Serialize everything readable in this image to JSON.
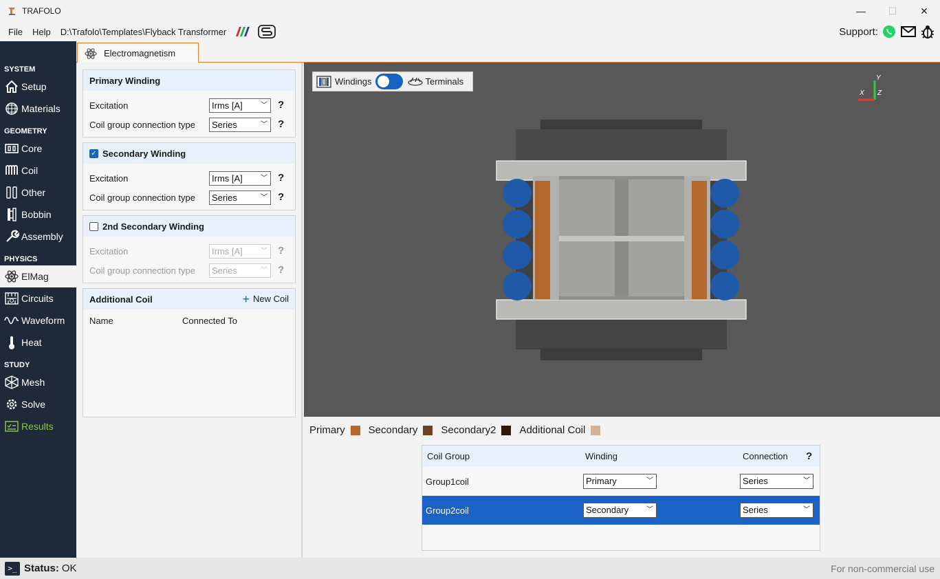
{
  "window": {
    "title": "TRAFOLO",
    "minimize": "—",
    "maximize": "☐",
    "close": "✕"
  },
  "menu": {
    "file": "File",
    "help": "Help",
    "path": "D:\\Trafolo\\Templates\\Flyback Transformer",
    "support": "Support:"
  },
  "tab": {
    "label": "Electromagnetism"
  },
  "sidebar": {
    "system": "SYSTEM",
    "setup": "Setup",
    "materials": "Materials",
    "geometry": "GEOMETRY",
    "core": "Core",
    "coil": "Coil",
    "other": "Other",
    "bobbin": "Bobbin",
    "assembly": "Assembly",
    "physics": "PHYSICS",
    "elmag": "ElMag",
    "circuits": "Circuits",
    "waveform": "Waveform",
    "heat": "Heat",
    "study": "STUDY",
    "mesh": "Mesh",
    "solve": "Solve",
    "results": "Results"
  },
  "panel": {
    "primary": {
      "title": "Primary Winding",
      "excitation_label": "Excitation",
      "excitation_value": "Irms [A]",
      "conn_label": "Coil group connection type",
      "conn_value": "Series"
    },
    "secondary": {
      "title": "Secondary Winding",
      "checked": true,
      "excitation_label": "Excitation",
      "excitation_value": "Irms [A]",
      "conn_label": "Coil group connection type",
      "conn_value": "Series"
    },
    "secondary2": {
      "title": "2nd Secondary Winding",
      "checked": false,
      "excitation_label": "Excitation",
      "excitation_value": "Irms [A]",
      "conn_label": "Coil group connection type",
      "conn_value": "Series"
    },
    "additional": {
      "title": "Additional Coil",
      "new_coil": "New Coil",
      "col_name": "Name",
      "col_connected": "Connected To"
    },
    "help": "?"
  },
  "viewport": {
    "windings": "Windings",
    "terminals": "Terminals",
    "axis_x": "X",
    "axis_y": "Y",
    "axis_z": "Z"
  },
  "legend": [
    {
      "label": "Primary",
      "color": "#b5682e"
    },
    {
      "label": "Secondary",
      "color": "#6a4420"
    },
    {
      "label": "Secondary2",
      "color": "#2e1a0c"
    },
    {
      "label": "Additional Coil",
      "color": "#d2b39a"
    }
  ],
  "coil_table": {
    "headers": {
      "group": "Coil Group",
      "winding": "Winding",
      "connection": "Connection",
      "help": "?"
    },
    "rows": [
      {
        "group": "Group1coil",
        "winding": "Primary",
        "connection": "Series",
        "selected": false
      },
      {
        "group": "Group2coil",
        "winding": "Secondary",
        "connection": "Series",
        "selected": true
      }
    ]
  },
  "status": {
    "label": "Status:",
    "value": "OK",
    "license": "For non-commercial use",
    "terminal_glyph": ">_"
  },
  "colors": {
    "accent": "#e07a2a",
    "sidebar": "#1e2a3a",
    "selection": "#1b62c6",
    "results": "#8bc34a"
  }
}
